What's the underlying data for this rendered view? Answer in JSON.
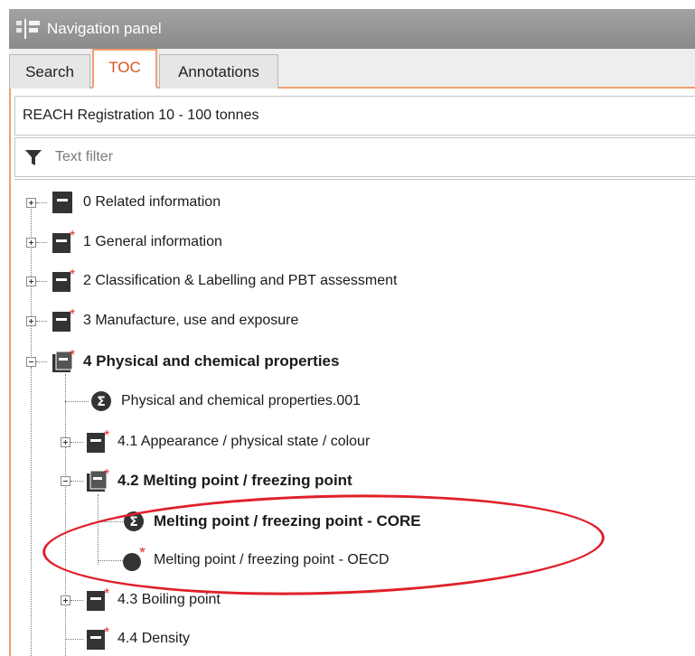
{
  "window": {
    "title": "Navigation panel"
  },
  "tabs": [
    {
      "label": "Search",
      "active": false
    },
    {
      "label": "TOC",
      "active": true
    },
    {
      "label": "Annotations",
      "active": false
    }
  ],
  "dataset": {
    "value": "REACH Registration 10 - 100 tonnes"
  },
  "filter": {
    "placeholder": "Text filter"
  },
  "tree": {
    "items": [
      {
        "label": "0 Related information",
        "required": false,
        "expanded": false,
        "bold": false
      },
      {
        "label": "1 General information",
        "required": true,
        "expanded": false,
        "bold": false
      },
      {
        "label": "2 Classification & Labelling and PBT assessment",
        "required": true,
        "expanded": false,
        "bold": false
      },
      {
        "label": "3 Manufacture, use and exposure",
        "required": true,
        "expanded": false,
        "bold": false
      },
      {
        "label": "4 Physical and chemical properties",
        "required": true,
        "expanded": true,
        "bold": true
      },
      {
        "label": "Physical and chemical properties.001",
        "type": "summary",
        "bold": false
      },
      {
        "label": "4.1 Appearance / physical state / colour",
        "required": true,
        "expanded": false,
        "bold": false
      },
      {
        "label": "4.2 Melting point / freezing point",
        "required": true,
        "expanded": true,
        "bold": true
      },
      {
        "label": "Melting point / freezing point - CORE",
        "type": "summary",
        "bold": true
      },
      {
        "label": "Melting point / freezing point - OECD",
        "type": "record",
        "required": true,
        "bold": false
      },
      {
        "label": "4.3 Boiling point",
        "required": true,
        "expanded": false,
        "bold": false
      },
      {
        "label": "4.4 Density",
        "required": true,
        "bold": false
      }
    ]
  },
  "colors": {
    "accent": "#f0a070",
    "active_tab_text": "#d9531e",
    "required_star": "#e03030",
    "highlight": "#e0202a"
  }
}
